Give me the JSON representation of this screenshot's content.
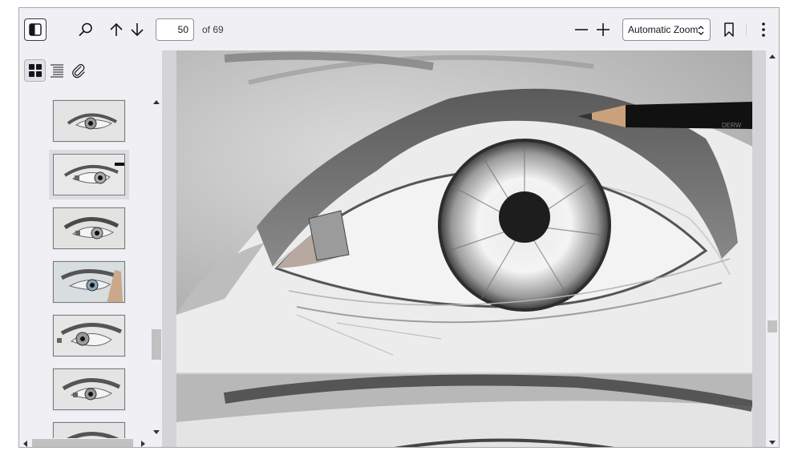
{
  "toolbar": {
    "page_number": "50",
    "page_count_text": "of 69",
    "zoom_value": "Automatic Zoom"
  },
  "icons": {
    "sidebar_toggle": "sidebar-toggle-icon",
    "find": "search-icon",
    "previous": "arrow-up-icon",
    "next": "arrow-down-icon",
    "zoom_out": "minus-icon",
    "zoom_in": "plus-icon",
    "bookmark": "bookmark-icon",
    "more": "kebab-menu-icon",
    "thumbnails": "grid-icon",
    "outline": "list-icon",
    "attachments": "paperclip-icon"
  },
  "document": {
    "pencil_brand": "DERW"
  }
}
